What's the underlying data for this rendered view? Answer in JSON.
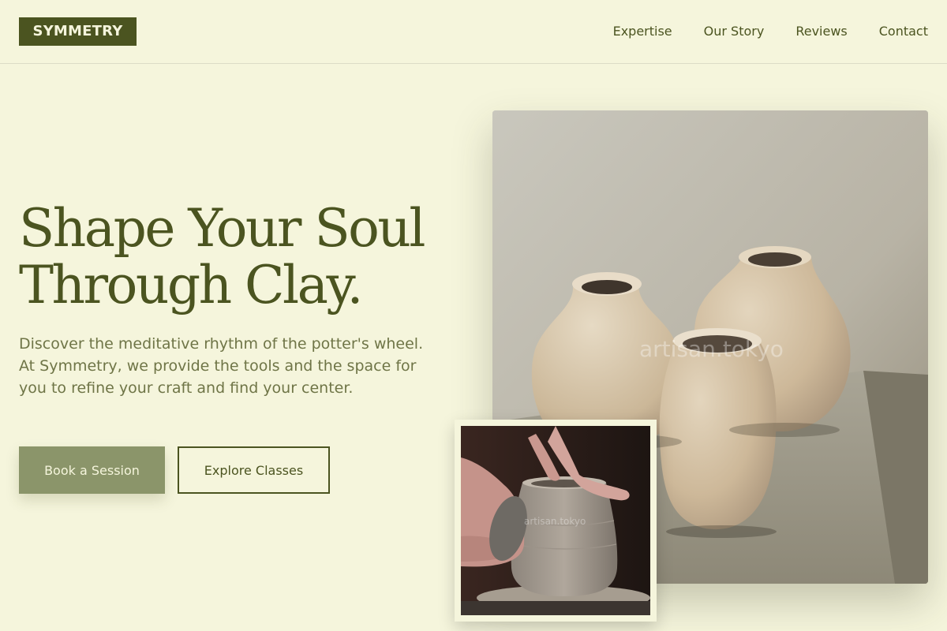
{
  "brand": {
    "logo_text": "SYMMETRY"
  },
  "nav": {
    "items": [
      "Expertise",
      "Our Story",
      "Reviews",
      "Contact"
    ]
  },
  "hero": {
    "headline_line1": "Shape Your Soul",
    "headline_line2": "Through Clay.",
    "description": "Discover the meditative rhythm of the potter's wheel. At Symmetry, we provide the tools and the space for you to refine your craft and find your center.",
    "primary_cta": "Book a Session",
    "secondary_cta": "Explore Classes"
  },
  "images": {
    "main_watermark": "artisan.tokyo",
    "inset_watermark": "artisan.tokyo"
  },
  "colors": {
    "background": "#f5f5dc",
    "primary": "#4b5420",
    "accent": "#8b956a",
    "muted_text": "#6f7547"
  },
  "icons": []
}
